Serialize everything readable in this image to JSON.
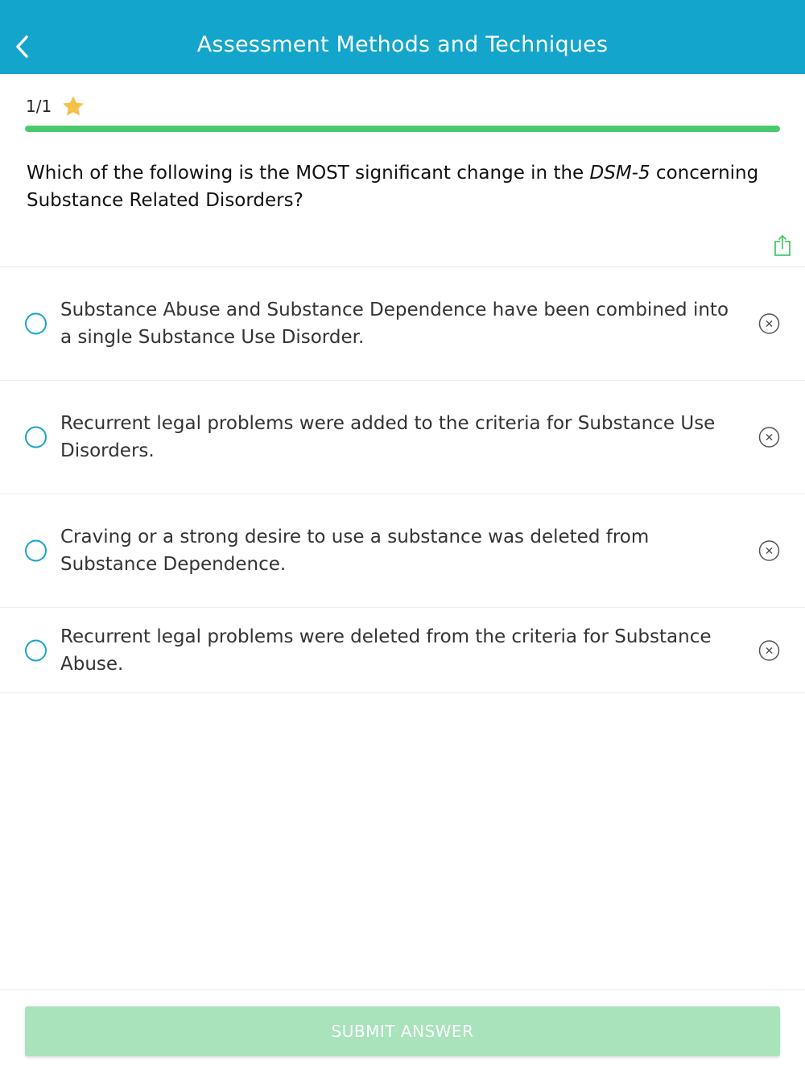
{
  "header": {
    "title": "Assessment Methods and Techniques",
    "back_icon": "chevron-left-icon",
    "background": "#14a5cc"
  },
  "progress": {
    "count_label": "1/1",
    "star_icon": "star-icon",
    "star_color": "#f5c04a",
    "fraction": 1.0,
    "fill_color": "#4cc96d"
  },
  "question": {
    "text_before": "Which of the following is the MOST significant change in the ",
    "text_italic": "DSM-5",
    "text_after": " concerning Substance Related Disorders?"
  },
  "share_icon": "share-icon",
  "options": [
    {
      "text": "Substance Abuse and Substance Dependence have been combined into a single Substance Use Disorder."
    },
    {
      "text": "Recurrent legal problems were added to the criteria for Substance Use Disorders."
    },
    {
      "text": "Craving or a strong desire to use a substance was deleted from Substance Dependence."
    },
    {
      "text": "Recurrent legal problems were deleted from the criteria for Substance Abuse."
    }
  ],
  "submit": {
    "label": "SUBMIT ANSWER",
    "color": "#a8e3bb"
  }
}
